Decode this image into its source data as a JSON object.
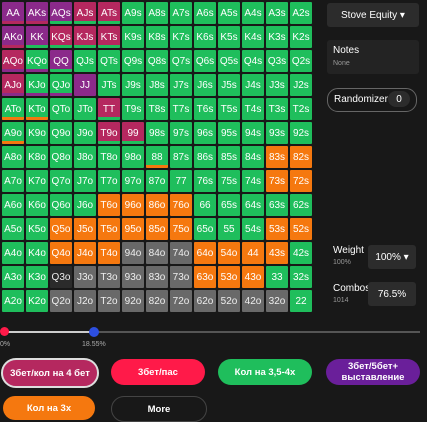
{
  "matrix": {
    "rows": [
      [
        "AA",
        "AKs",
        "AQs",
        "AJs",
        "ATs",
        "A9s",
        "A8s",
        "A7s",
        "A6s",
        "A5s",
        "A4s",
        "A3s",
        "A2s"
      ],
      [
        "AKo",
        "KK",
        "KQs",
        "KJs",
        "KTs",
        "K9s",
        "K8s",
        "K7s",
        "K6s",
        "K5s",
        "K4s",
        "K3s",
        "K2s"
      ],
      [
        "AQo",
        "KQo",
        "QQ",
        "QJs",
        "QTs",
        "Q9s",
        "Q8s",
        "Q7s",
        "Q6s",
        "Q5s",
        "Q4s",
        "Q3s",
        "Q2s"
      ],
      [
        "AJo",
        "KJo",
        "QJo",
        "JJ",
        "JTs",
        "J9s",
        "J8s",
        "J7s",
        "J6s",
        "J5s",
        "J4s",
        "J3s",
        "J2s"
      ],
      [
        "ATo",
        "KTo",
        "QTo",
        "JTo",
        "TT",
        "T9s",
        "T8s",
        "T7s",
        "T6s",
        "T5s",
        "T4s",
        "T3s",
        "T2s"
      ],
      [
        "A9o",
        "K9o",
        "Q9o",
        "J9o",
        "T9o",
        "99",
        "98s",
        "97s",
        "96s",
        "95s",
        "94s",
        "93s",
        "92s"
      ],
      [
        "A8o",
        "K8o",
        "Q8o",
        "J8o",
        "T8o",
        "98o",
        "88",
        "87s",
        "86s",
        "85s",
        "84s",
        "83s",
        "82s"
      ],
      [
        "A7o",
        "K7o",
        "Q7o",
        "J7o",
        "T7o",
        "97o",
        "87o",
        "77",
        "76s",
        "75s",
        "74s",
        "73s",
        "72s"
      ],
      [
        "A6o",
        "K6o",
        "Q6o",
        "J6o",
        "T6o",
        "96o",
        "86o",
        "76o",
        "66",
        "65s",
        "64s",
        "63s",
        "62s"
      ],
      [
        "A5o",
        "K5o",
        "Q5o",
        "J5o",
        "T5o",
        "95o",
        "85o",
        "75o",
        "65o",
        "55",
        "54s",
        "53s",
        "52s"
      ],
      [
        "A4o",
        "K4o",
        "Q4o",
        "J4o",
        "T4o",
        "94o",
        "84o",
        "74o",
        "64o",
        "54o",
        "44",
        "43s",
        "42s"
      ],
      [
        "A3o",
        "K3o",
        "Q3o",
        "J3o",
        "T3o",
        "93o",
        "83o",
        "73o",
        "63o",
        "53o",
        "43o",
        "33",
        "32s"
      ],
      [
        "A2o",
        "K2o",
        "Q2o",
        "J2o",
        "T2o",
        "92o",
        "82o",
        "72o",
        "62o",
        "52o",
        "42o",
        "32o",
        "22"
      ]
    ],
    "colors": [
      "pppmmgggggggg",
      "ppmmmgggggggg",
      "mgpgggggggggg",
      "mggpggggggggg",
      "ggggmgggggggg",
      "ggggmmggggggg",
      "gggggggggggoo",
      "gggggggggggoo",
      "ggggooooggggg",
      "ggoooooogggoo",
      "ggoooyyyoooog",
      "ggkyyyyyooogg",
      "ggyyyyyyyyyyg"
    ],
    "bars": {
      "0-0": "#b5285f",
      "0-1": "#b5285f",
      "0-2": "#1fbe5c",
      "0-3": "#1fbe5c",
      "0-4": "#1fbe5c",
      "1-0": "#b5285f",
      "1-1": "#1fbe5c",
      "1-2": "#1fbe5c",
      "1-3": "#1fbe5c",
      "1-4": "#1fbe5c",
      "2-0": "#8b2a8a",
      "2-1": "#8b2a8a",
      "2-2": "#1fbe5c",
      "3-0": "#8b2a8a",
      "3-1": "#8b2a8a",
      "3-2": "#8b2a8a",
      "4-0": "#f5780f",
      "4-1": "#f5780f",
      "4-4": "#1fbe5c",
      "5-0": "#f5780f",
      "5-4": "#1fbe5c",
      "5-5": "#1fbe5c",
      "6-6": "#f5780f"
    }
  },
  "stove_dropdown": {
    "label": "Stove Equity ▾"
  },
  "notes": {
    "title": "Notes",
    "value": "None"
  },
  "randomizer": {
    "label": "Randomizer",
    "value": "0"
  },
  "weight": {
    "label": "Weight",
    "sub": "100%",
    "value": "100% ▾"
  },
  "combos": {
    "label": "Combos",
    "sub": "1014",
    "value": "76.5%"
  },
  "slider": {
    "left_label": "0%",
    "right_label": "18.55%",
    "low": 0,
    "high": 18.55
  },
  "actions": [
    {
      "label": "3бет/кол на 4 бет",
      "color": "#b5285f"
    },
    {
      "label": "3бет/пас",
      "color": "#ff1a49"
    },
    {
      "label": "Кол на 3,5-4х",
      "color": "#1fbe5c"
    },
    {
      "label": "3бет/5бет+ выставление",
      "color": "#6a1f9a"
    },
    {
      "label": "Кол на 3х",
      "color": "#f5780f"
    },
    {
      "label": "More",
      "color": "#181818"
    }
  ]
}
